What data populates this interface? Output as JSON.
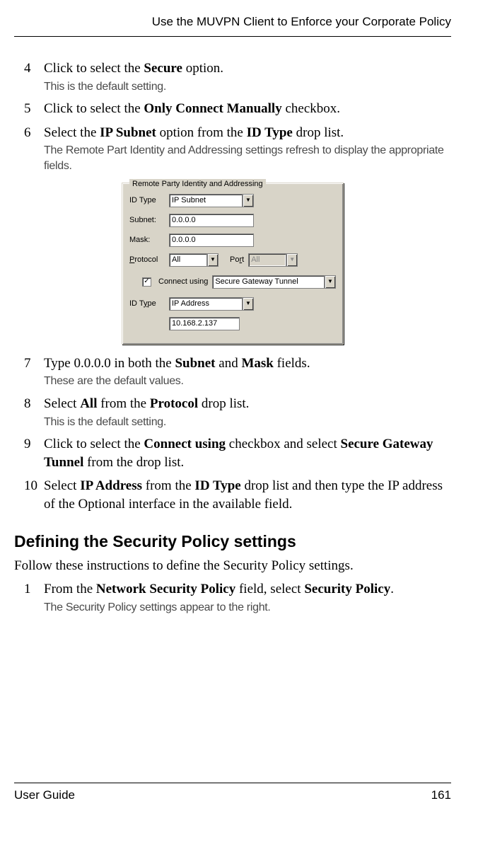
{
  "header": {
    "title": "Use the MUVPN Client to Enforce your Corporate Policy"
  },
  "steps": [
    {
      "num": "4",
      "parts": [
        "Click to select the ",
        "Secure",
        " option."
      ],
      "note": "This is the default setting."
    },
    {
      "num": "5",
      "parts": [
        "Click to select the ",
        "Only Connect Manually",
        " checkbox."
      ]
    },
    {
      "num": "6",
      "parts": [
        "Select the ",
        "IP Subnet",
        " option from the ",
        "ID Type",
        " drop list."
      ],
      "note": "The Remote Part Identity and Addressing settings refresh to display the appropriate fields."
    },
    {
      "num": "7",
      "parts": [
        "Type 0.0.0.0 in both the ",
        "Subnet",
        " and ",
        "Mask",
        " fields."
      ],
      "note": "These are the default values."
    },
    {
      "num": "8",
      "parts": [
        "Select ",
        "All",
        " from the ",
        "Protocol",
        " drop list."
      ],
      "note": "This is the default setting."
    },
    {
      "num": "9",
      "parts": [
        "Click to select the ",
        "Connect using",
        " checkbox and select ",
        "Secure Gateway Tunnel",
        " from the drop list."
      ]
    },
    {
      "num": "10",
      "parts": [
        "Select ",
        "IP Address",
        " from the ",
        "ID Type",
        " drop list and then type the IP address of the Optional interface in the available field."
      ]
    }
  ],
  "dialog": {
    "title": "Remote Party Identity and Addressing",
    "idtype_label": "ID Type",
    "idtype_value": "IP Subnet",
    "subnet_label": "Subnet:",
    "subnet_value": "0.0.0.0",
    "mask_label": "Mask:",
    "mask_value": "0.0.0.0",
    "protocol_label_pre": "P",
    "protocol_label_post": "rotocol",
    "protocol_value": "All",
    "port_label_pre": "Po",
    "port_label_u": "r",
    "port_label_post": "t",
    "port_value": "All",
    "connect_label": "Connect using",
    "connect_value": "Secure Gateway Tunnel",
    "idtype2_label_pre": "ID T",
    "idtype2_label_u": "y",
    "idtype2_label_post": "pe",
    "idtype2_value": "IP Address",
    "ip_value": "10.168.2.137",
    "check": "✓"
  },
  "section": {
    "heading": "Defining the Security Policy settings",
    "intro": "Follow these instructions to define the Security Policy settings."
  },
  "sec_steps": [
    {
      "num": "1",
      "parts": [
        "From the ",
        "Network Security Policy",
        " field, select ",
        "Security Policy",
        "."
      ],
      "note": "The Security Policy settings appear to the right."
    }
  ],
  "footer": {
    "left": "User Guide",
    "right": "161"
  }
}
